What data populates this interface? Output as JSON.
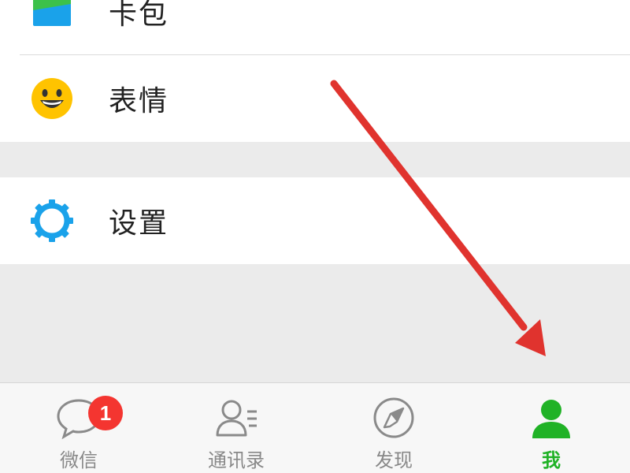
{
  "menu": {
    "card_pack_label": "卡包",
    "stickers_label": "表情",
    "settings_label": "设置"
  },
  "tabbar": {
    "chats_label": "微信",
    "chats_badge": "1",
    "contacts_label": "通讯录",
    "discover_label": "发现",
    "me_label": "我",
    "active_tab": "me"
  },
  "icons": {
    "card_pack": "wallet-icon",
    "stickers": "smiley-icon",
    "settings": "gear-icon",
    "chats": "chat-bubble-icon",
    "contacts": "contacts-icon",
    "discover": "compass-icon",
    "me": "person-icon"
  },
  "colors": {
    "accent_green": "#20b226",
    "badge_red": "#f43530",
    "annotation_arrow": "#e0332e",
    "settings_blue": "#1aa2ea",
    "smiley_yellow": "#ffc300"
  }
}
